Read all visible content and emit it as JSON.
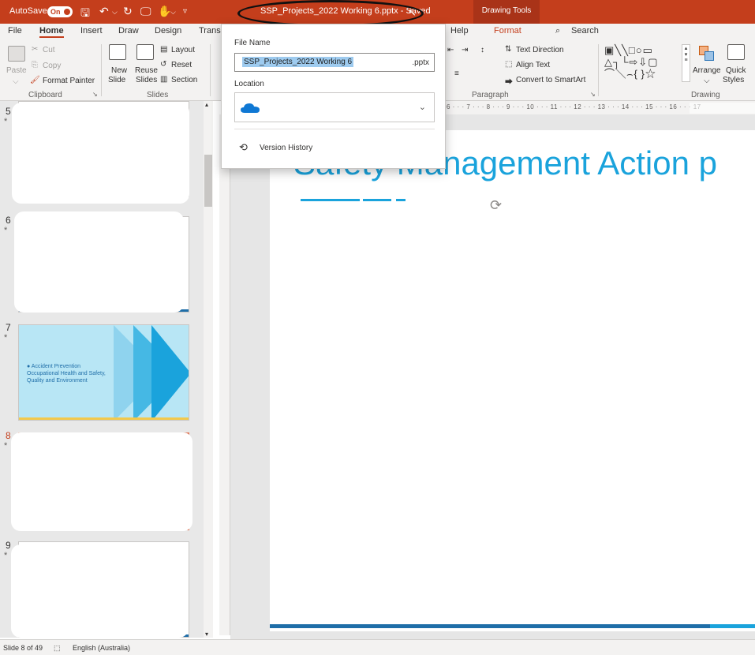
{
  "titlebar": {
    "autosave_label": "AutoSave",
    "autosave_state": "On",
    "doc_title": "SSP_Projects_2022 Working 6.pptx  -  Saved",
    "context_tab": "Drawing Tools",
    "accent_color": "#c43e1c"
  },
  "tabs": [
    "File",
    "Home",
    "Insert",
    "Draw",
    "Design",
    "Transi",
    "Help",
    "Format",
    "Search"
  ],
  "ribbon": {
    "paste": "Paste",
    "cut": "Cut",
    "copy": "Copy",
    "format_painter": "Format Painter",
    "clipboard": "Clipboard",
    "new_slide": "New",
    "new_slide2": "Slide",
    "reuse": "Reuse",
    "reuse2": "Slides",
    "layout": "Layout",
    "reset": "Reset",
    "section": "Section",
    "slides_group": "Slides",
    "text_direction": "Text Direction",
    "align_text": "Align Text",
    "convert_smartart": "Convert to SmartArt",
    "paragraph": "Paragraph",
    "arrange": "Arrange",
    "quick": "Quick",
    "styles": "Styles",
    "drawing": "Drawing"
  },
  "ruler": "6 · · · 7 · · · 8 · · · 9 · · · 10 · · · 11 · · · 12 · · · 13 · · · 14 · · · 15 · · · 16 · · · 17",
  "file_popup": {
    "file_name_label": "File Name",
    "file_name_value": "SSP_Projects_2022 Working 6",
    "extension": ".pptx",
    "location_label": "Location",
    "location_icon": "onedrive-cloud-icon",
    "version_history": "Version History"
  },
  "thumbnails": [
    {
      "num": "5",
      "star": "*"
    },
    {
      "num": "6",
      "star": "*"
    },
    {
      "num": "7",
      "star": "*",
      "text": "● Accident Prevention\nOccupational Health and Safety,\nQuality and Environment"
    },
    {
      "num": "8",
      "star": "*"
    },
    {
      "num": "9",
      "star": "*"
    }
  ],
  "slide": {
    "title": "Safety Management Action p"
  },
  "status": {
    "slide_info": "Slide 8 of 49",
    "language": "English (Australia)"
  }
}
